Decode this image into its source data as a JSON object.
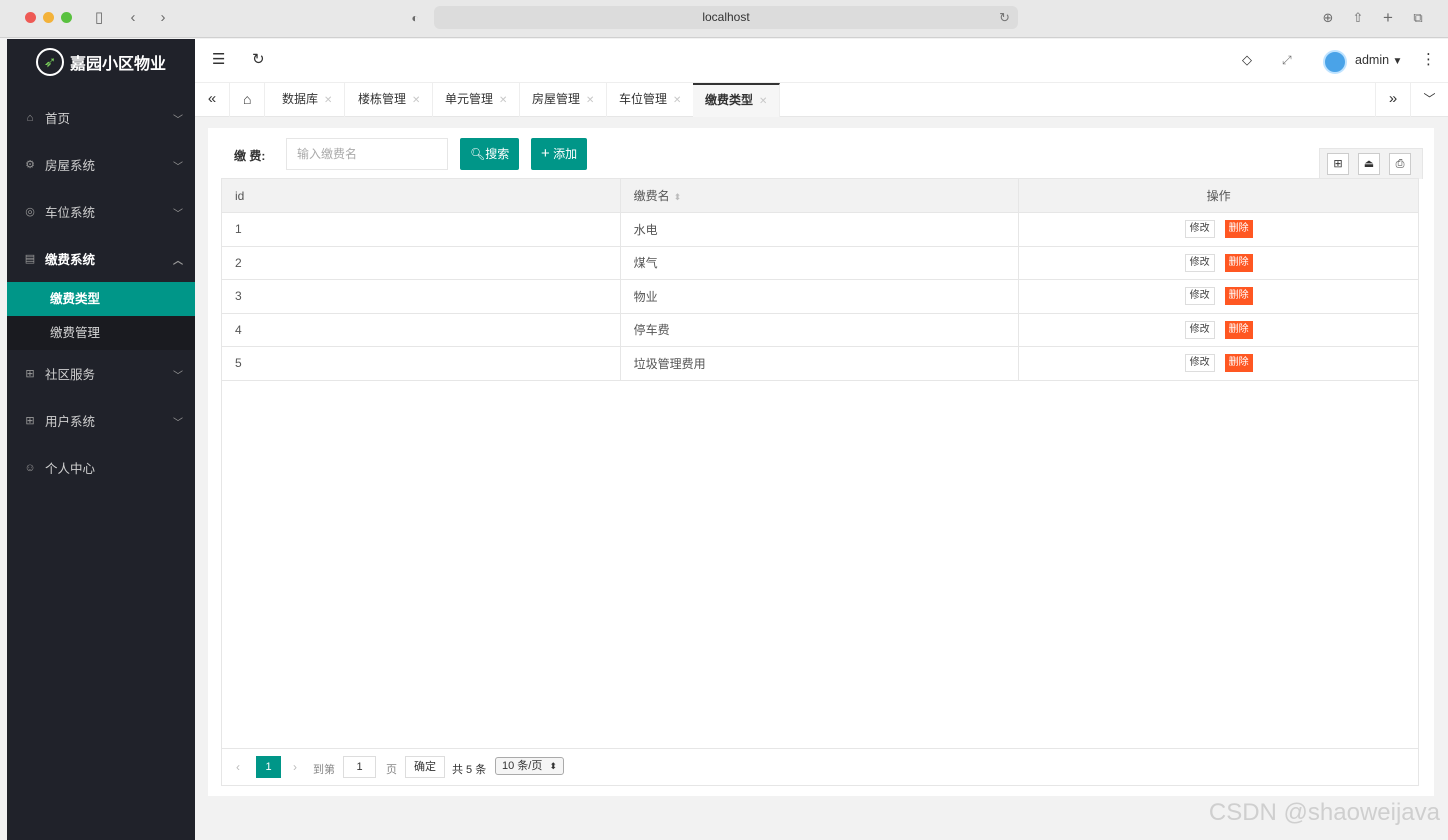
{
  "browser": {
    "url": "localhost",
    "reload_icon": "↻"
  },
  "sidebar": {
    "logo_text": "嘉园小区物业",
    "items": [
      {
        "label": "首页",
        "icon": "home-icon",
        "expanded": false
      },
      {
        "label": "房屋系统",
        "icon": "gear-icon",
        "expanded": false
      },
      {
        "label": "车位系统",
        "icon": "cube-icon",
        "expanded": false
      },
      {
        "label": "缴费系统",
        "icon": "panel-icon",
        "expanded": true
      },
      {
        "label": "社区服务",
        "icon": "apps-icon",
        "expanded": false
      },
      {
        "label": "用户系统",
        "icon": "apps-icon",
        "expanded": false
      },
      {
        "label": "个人中心",
        "icon": "user-icon",
        "expanded": false
      }
    ],
    "sub_items": [
      {
        "label": "缴费类型",
        "active": true
      },
      {
        "label": "缴费管理",
        "active": false
      }
    ]
  },
  "header": {
    "user": "admin"
  },
  "tabs": [
    {
      "label": "数据库"
    },
    {
      "label": "楼栋管理"
    },
    {
      "label": "单元管理"
    },
    {
      "label": "房屋管理"
    },
    {
      "label": "车位管理"
    },
    {
      "label": "缴费类型",
      "active": true
    }
  ],
  "search": {
    "label": "缴 费:",
    "placeholder": "输入缴费名",
    "search_button": "搜索",
    "add_button": "添加"
  },
  "table": {
    "columns": [
      "id",
      "缴费名",
      "操作"
    ],
    "edit_label": "修改",
    "delete_label": "删除",
    "rows": [
      {
        "id": "1",
        "name": "水电"
      },
      {
        "id": "2",
        "name": "煤气"
      },
      {
        "id": "3",
        "name": "物业"
      },
      {
        "id": "4",
        "name": "停车费"
      },
      {
        "id": "5",
        "name": "垃圾管理费用"
      }
    ]
  },
  "pager": {
    "current_page": "1",
    "goto_prefix": "到第",
    "goto_value": "1",
    "goto_suffix": "页",
    "confirm": "确定",
    "total": "共 5 条",
    "page_size": "10 条/页"
  },
  "watermark": "CSDN @shaoweijava",
  "colors": {
    "accent": "#009688",
    "danger": "#ff5722",
    "sidebar_bg": "#20222a"
  }
}
